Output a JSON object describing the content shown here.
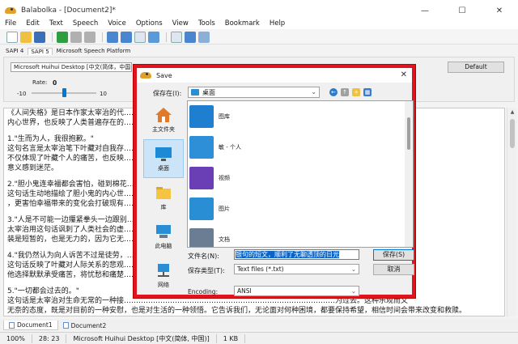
{
  "window": {
    "title": "Balabolka - [Document2]*",
    "minimize": "—",
    "maximize": "☐",
    "close": "✕"
  },
  "menu": [
    "File",
    "Edit",
    "Text",
    "Speech",
    "Voice",
    "Options",
    "View",
    "Tools",
    "Bookmark",
    "Help"
  ],
  "engine_tabs": [
    "SAPI 4",
    "SAPI 5",
    "Microsoft Speech Platform"
  ],
  "voice": {
    "selected": "Microsoft Huihui Desktop [中文(简体，中国)]",
    "default_button": "Default",
    "rate_label": "Rate:",
    "rate_value": "0",
    "rate_min": "-10",
    "rate_max": "10",
    "rate_fraction": 0.5
  },
  "editor_lines": [
    {
      "text": "《人间失格》是日本作家太宰治的代……………………………………………………………………………揭示了主人公叶藏的",
      "gap": false
    },
    {
      "text": "内心世界，也反映了人类普遍存在的……………………………………………………………………………存感悟。",
      "gap": false
    },
    {
      "text": "1.\"生而为人，我很抱歉。\"",
      "gap": true
    },
    {
      "text": "这句名言是太宰治笔下叶藏对自我存……………………………………………………………………………公无法承受。这种情绪",
      "gap": false
    },
    {
      "text": "不仅体现了叶藏个人的痛苦，也反映……………………………………………………………………………生产生怀疑，对生命的",
      "gap": false
    },
    {
      "text": "意义感到迷茫。",
      "gap": false
    },
    {
      "text": "2.\"胆小鬼连幸福都会害怕，碰到棉花……………………………………………………………………………",
      "gap": true
    },
    {
      "text": "这句话生动地描绘了胆小鬼的内心世……………………………………………………………………………受幸福，因为害怕失去",
      "gap": false
    },
    {
      "text": "，更害怕幸福带来的变化会打破现有……………………………………………………………………………",
      "gap": false
    },
    {
      "text": "3.\"人是不可能一边攥紧拳头一边跟别……………………………………………………………………………",
      "gap": true
    },
    {
      "text": "太宰治用这句话讽刺了人类社会的虚……………………………………………………………………………而不满。然而，这种伪",
      "gap": false
    },
    {
      "text": "装是短暂的，也是无力的，因为它无……………………………………………………………………………",
      "gap": false
    },
    {
      "text": "4.\"我仍然认为向人诉苦不过是徒劳，……………………………………………………………………………",
      "gap": true
    },
    {
      "text": "这句话反映了叶藏对人际关系的悲观……………………………………………………………………………的隔阂和误解。因此，",
      "gap": false
    },
    {
      "text": "他选择默默承受痛苦，将忧愁和痛楚……………………………………………………………………………的渴望。",
      "gap": false
    },
    {
      "text": "5.\"一切都会过去的。\"",
      "gap": true
    },
    {
      "text": "这句话是太宰治对生命无常的一种接……………………………………………………………………………为过去。这种乐观而又",
      "gap": false
    },
    {
      "text": "无奈的态度，既是对目前的一种安慰，也是对生活的一种领悟。它告诉我们，无论面对何种困境，都要保持希望，相信时间会带来改变和救赎。",
      "gap": false
    }
  ],
  "doc_tabs": [
    "Document1",
    "Document2"
  ],
  "status": {
    "chars": "100%",
    "position": "28: 23",
    "voice": "Microsoft Huihui Desktop [中文(简体, 中国)]",
    "size": "1 KB"
  },
  "dialog": {
    "title": "Save",
    "close": "✕",
    "save_in_label": "保存在(I):",
    "save_in_value": "桌面",
    "places": [
      {
        "label": "主文件夹",
        "icon": "home-icon"
      },
      {
        "label": "桌面",
        "icon": "desktop-icon"
      },
      {
        "label": "库",
        "icon": "library-icon"
      },
      {
        "label": "此电脑",
        "icon": "computer-icon"
      },
      {
        "label": "网络",
        "icon": "network-icon"
      }
    ],
    "files": [
      {
        "name": "图库",
        "icon": "gallery-icon",
        "color": "#1e7fd0"
      },
      {
        "name": "敏 - 个人",
        "icon": "cloud-icon",
        "color": "#2c8fd8"
      },
      {
        "name": "视频",
        "icon": "video-icon",
        "color": "#6a3fb5"
      },
      {
        "name": "图片",
        "icon": "pictures-icon",
        "color": "#2a8ed4"
      },
      {
        "name": "文档",
        "icon": "documents-icon",
        "color": "#6b7d93"
      }
    ],
    "filename_label": "文件名(N):",
    "filename_value": "银句的短文，顺利了无聊透顶的日光",
    "filetype_label": "保存类型(T):",
    "filetype_value": "Text files (*.txt)",
    "save_button": "保存(S)",
    "cancel_button": "取消",
    "encoding_label": "Encoding:",
    "encoding_value": "ANSI"
  }
}
